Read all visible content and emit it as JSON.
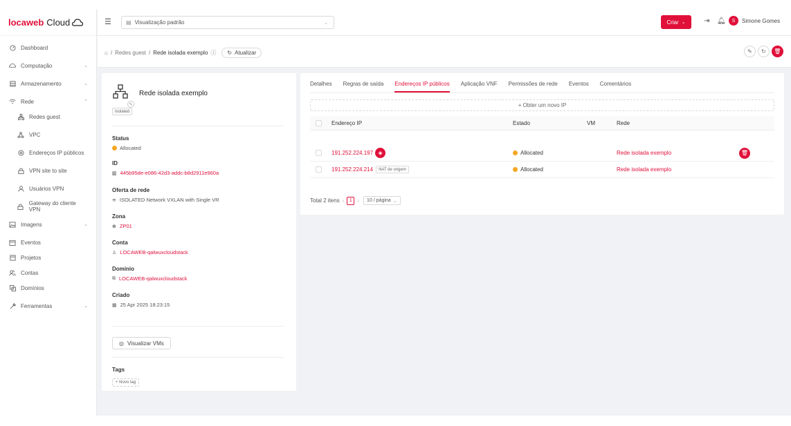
{
  "brand": {
    "name_part1": "locaweb",
    "name_part2": "Cloud"
  },
  "sidebar": {
    "items": [
      {
        "label": "Dashboard",
        "icon": "dashboard-icon"
      },
      {
        "label": "Computação",
        "icon": "cloud-icon",
        "chevron": "⌄"
      },
      {
        "label": "Armazenamento",
        "icon": "storage-icon",
        "chevron": "⌄"
      },
      {
        "label": "Rede",
        "icon": "wifi-icon",
        "chevron": "⌃"
      },
      {
        "label": "Redes guest",
        "icon": "network-icon",
        "sub": true
      },
      {
        "label": "VPC",
        "icon": "vpc-icon",
        "sub": true
      },
      {
        "label": "Endereços IP públicos",
        "icon": "ip-icon",
        "sub": true
      },
      {
        "label": "VPN site to site",
        "icon": "lock-icon",
        "sub": true
      },
      {
        "label": "Usuários VPN",
        "icon": "user-icon",
        "sub": true
      },
      {
        "label": "Gateway do cliente VPN",
        "icon": "lock-icon",
        "sub": true
      },
      {
        "label": "Imagens",
        "icon": "image-icon",
        "chevron": "⌄"
      },
      {
        "label": "Eventos",
        "icon": "calendar-icon"
      },
      {
        "label": "Projetos",
        "icon": "project-icon"
      },
      {
        "label": "Contas",
        "icon": "team-icon"
      },
      {
        "label": "Domínios",
        "icon": "domain-icon"
      },
      {
        "label": "Ferramentas",
        "icon": "tool-icon",
        "chevron": "⌄"
      }
    ]
  },
  "topbar": {
    "view_label": "Visualização padrão",
    "create_label": "Criar",
    "user_initial": "S",
    "user_name": "Simone Gomes"
  },
  "breadcrumb": {
    "parent": "Redes guest",
    "current": "Rede isolada exemplo",
    "refresh_label": "Atualizar"
  },
  "details": {
    "title": "Rede isolada exemplo",
    "tag": "Isolated",
    "status_label": "Status",
    "status_value": "Allocated",
    "id_label": "ID",
    "id_value": "445b95de-e086-42d3-addc-b8d2911e960a",
    "offer_label": "Oferta de rede",
    "offer_value": "ISOLATED Network VXLAN with Single VR",
    "zone_label": "Zona",
    "zone_value": "ZP01",
    "account_label": "Conta",
    "account_value": "LOCAWEB-qalwuxcloudstack",
    "domain_label": "Domínio",
    "domain_value": "LOCAWEB-qalwuxcloudstack",
    "created_label": "Criado",
    "created_value": "25 Apr 2025 18:23:15",
    "view_vms_label": "Visualizar VMs",
    "tags_label": "Tags",
    "new_tag_label": "+ Novo tag"
  },
  "tabs": [
    "Detalhes",
    "Regras de saída",
    "Endereços IP públicos",
    "Aplicação VNF",
    "Permissões de rede",
    "Eventos",
    "Comentários"
  ],
  "ip_table": {
    "new_ip_label": "+ Obter um novo IP",
    "headers": {
      "ip": "Endereço IP",
      "state": "Estado",
      "vm": "VM",
      "network": "Rede"
    },
    "rows": [
      {
        "ip": "191.252.224.197",
        "state": "Allocated",
        "vm": "",
        "network": "Rede isolada exemplo",
        "badge": ""
      },
      {
        "ip": "191.252.224.214",
        "state": "Allocated",
        "vm": "",
        "network": "Rede isolada exemplo",
        "badge": "NAT de origem"
      }
    ],
    "total_label": "Total 2 itens",
    "page": "1",
    "per_page": "10 / página"
  },
  "colors": {
    "accent": "#e0103a",
    "status_allocated": "#f5a623"
  }
}
